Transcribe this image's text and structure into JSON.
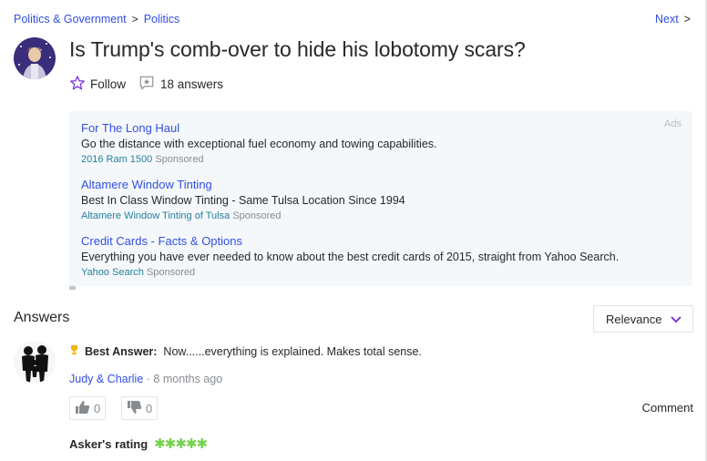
{
  "breadcrumb": {
    "category": "Politics & Government",
    "separator": ">",
    "subcategory": "Politics"
  },
  "next_label": "Next",
  "question": {
    "title": "Is Trump's comb-over to hide his lobotomy scars?",
    "follow_label": "Follow",
    "answers_count": "18 answers"
  },
  "ads": {
    "label": "Ads",
    "items": [
      {
        "title": "For The Long Haul",
        "description": "Go the distance with exceptional fuel economy and towing capabilities.",
        "source": "2016 Ram 1500",
        "sponsored": "Sponsored"
      },
      {
        "title": "Altamere Window Tinting",
        "description": "Best In Class Window Tinting - Same Tulsa Location Since 1994",
        "source": "Altamere Window Tinting of Tulsa",
        "sponsored": "Sponsored"
      },
      {
        "title": "Credit Cards - Facts & Options",
        "description": "Everything you have ever needed to know about the best credit cards of 2015, straight from Yahoo Search.",
        "source": "Yahoo Search",
        "sponsored": "Sponsored"
      }
    ]
  },
  "answers_section": {
    "heading": "Answers",
    "sort_label": "Relevance"
  },
  "best_answer": {
    "label": "Best Answer:",
    "text": "Now......everything is explained. Makes total sense.",
    "author": "Judy & Charlie",
    "time": " · 8 months ago",
    "upvotes": "0",
    "downvotes": "0",
    "comment_label": "Comment",
    "rating_label": "Asker's rating",
    "rating_stars": 5
  },
  "colors": {
    "link": "#324fe1",
    "star_rating": "#72d24c",
    "trophy": "#f0b800",
    "follow_star": "#6e28d9"
  },
  "icons": {
    "follow": "star-outline-icon",
    "answers": "speech-bubble-star-icon",
    "sort": "chevron-down-icon",
    "trophy": "trophy-icon",
    "thumbs_up": "thumbs-up-icon",
    "thumbs_down": "thumbs-down-icon"
  }
}
